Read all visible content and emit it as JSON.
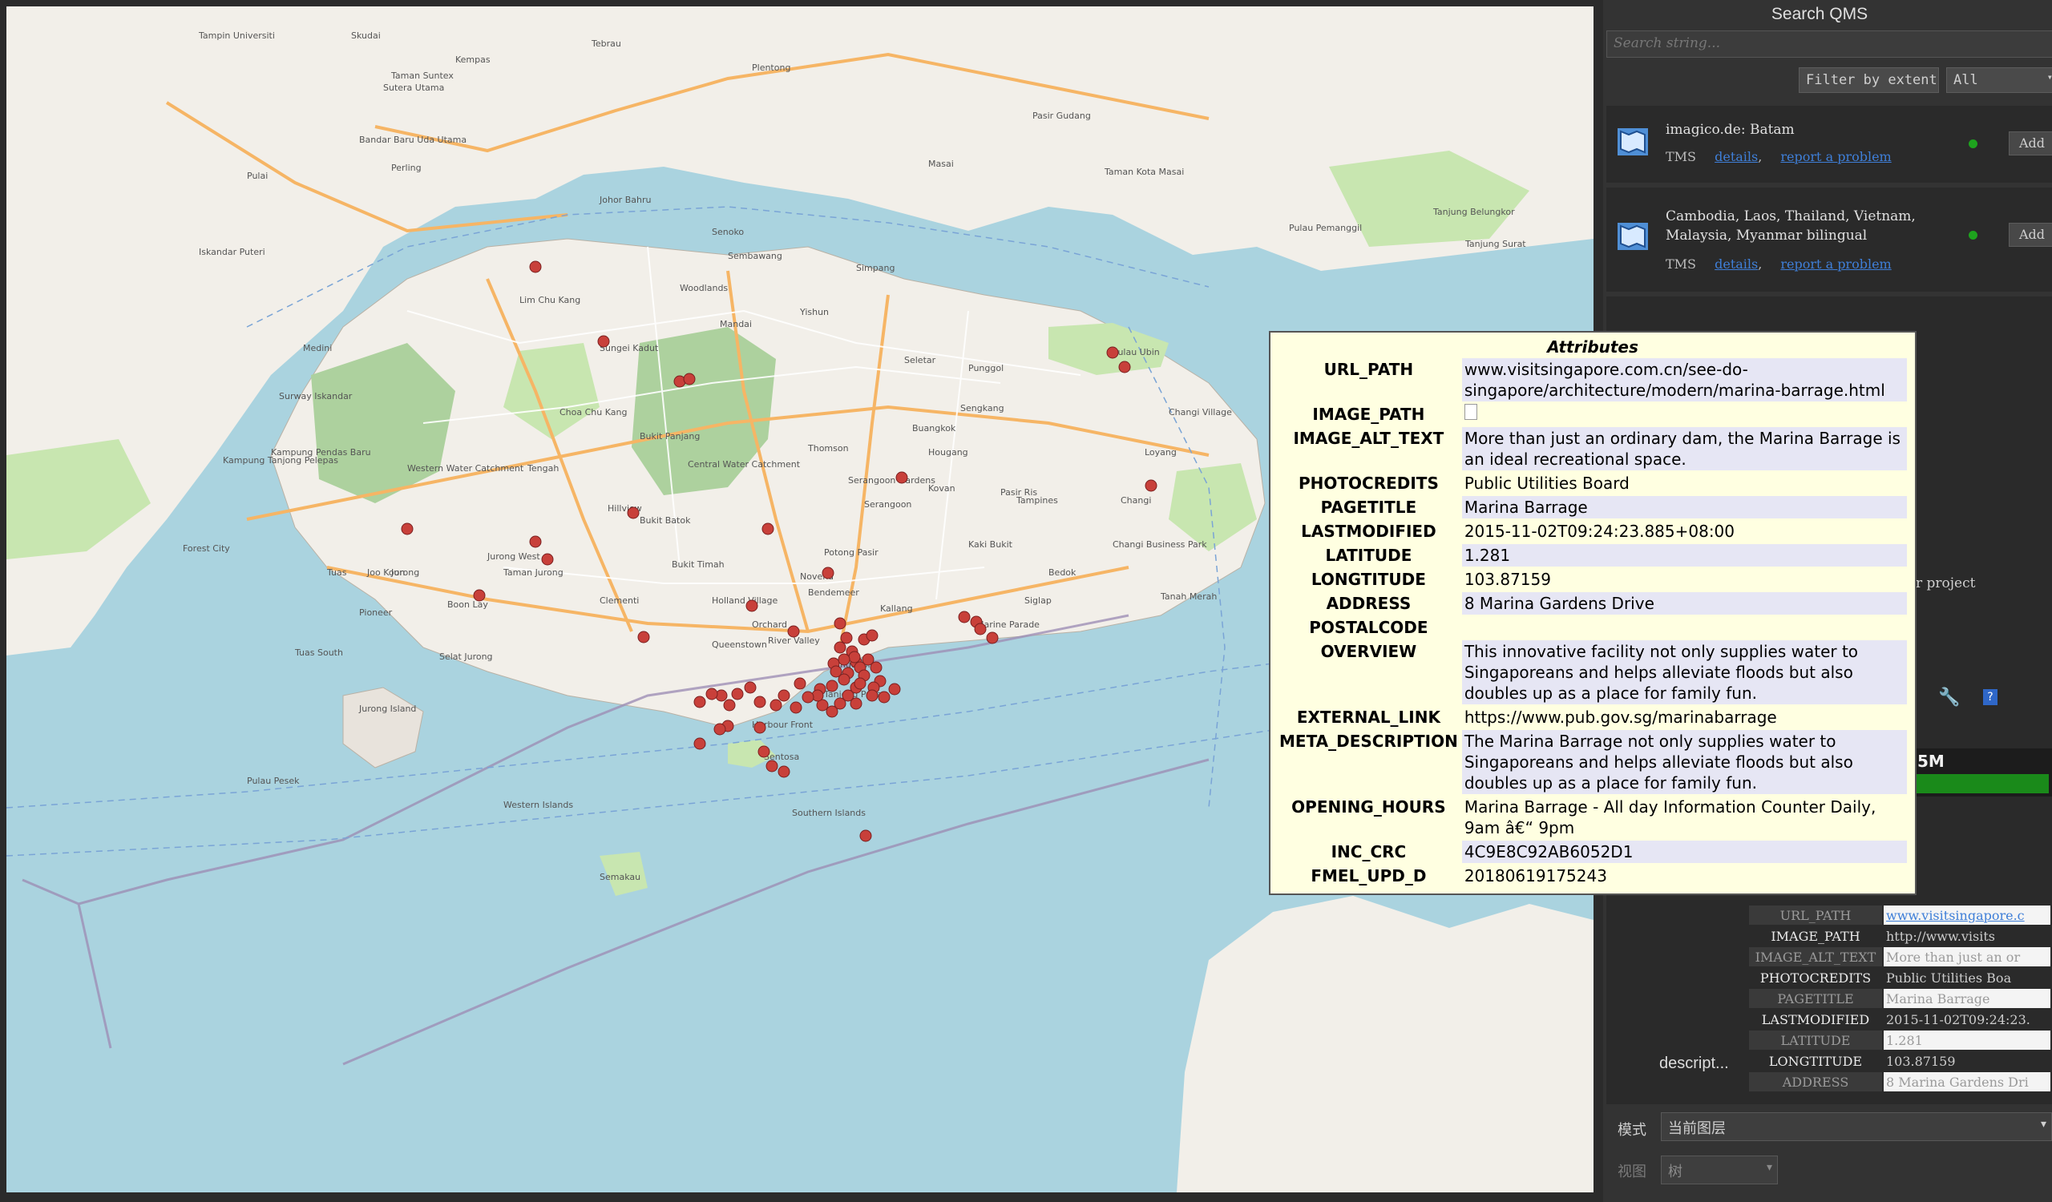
{
  "qms": {
    "title": "Search QMS",
    "search_placeholder": "Search string...",
    "filter_button": "Filter by extent",
    "filter_select": "All",
    "results": [
      {
        "name": "imagico.de: Batam",
        "type": "TMS",
        "details": "details",
        "report": "report a problem",
        "add": "Add"
      },
      {
        "name": "Cambodia, Laos, Thailand, Vietnam, Malaysia, Myanmar bilingual",
        "type": "TMS",
        "details": "details",
        "report": "report a problem",
        "add": "Add"
      }
    ]
  },
  "map": {
    "labels": [
      "Tampin Universiti",
      "Skudai",
      "Tebrau",
      "Plentong",
      "Kempas",
      "Taman Suntex",
      "Sutera Utama",
      "Johor Bahru",
      "Pulai",
      "Bandar Baru Uda Utama",
      "Perling",
      "Iskandar Puteri",
      "Pasir Gudang",
      "Masai",
      "Taman Kota Masai",
      "Senoko",
      "Sembawang",
      "Simpang",
      "Woodlands",
      "Mandai",
      "Lim Chu Kang",
      "Yishun",
      "Sungei Kadut",
      "Seletar",
      "Punggol",
      "Pulau Ubin",
      "Sengkang",
      "Buangkok",
      "Changi Village",
      "Hougang",
      "Serangoon Gardens",
      "Serangoon",
      "Kovan",
      "Pasir Ris",
      "Loyang",
      "Tampines",
      "Changi",
      "Kaki Bukit",
      "Changi Business Park",
      "Bedok",
      "Tanah Merah",
      "Siglap",
      "Marine Parade",
      "Kallang",
      "Potong Pasir",
      "Bendemeer",
      "Novena",
      "Orchard",
      "River Valley",
      "Singapore",
      "Tanjong Pagar",
      "Harbour Front",
      "Sentosa",
      "Southern Islands",
      "Queenstown",
      "Bukit Timah",
      "Holland Village",
      "Clementi",
      "Jurong West",
      "Taman Jurong",
      "Jurong",
      "Joo Koon",
      "Tuas",
      "Pioneer",
      "Boon Lay",
      "Tuas South",
      "Jurong Island",
      "Pulau Pesek",
      "Bukit Batok",
      "Hillview",
      "Bukit Panjang",
      "Choa Chu Kang",
      "Tengah",
      "Western Water Catchment",
      "Central Water Catchment",
      "Thomson",
      "Medini",
      "Surway Iskandar",
      "Kampung Pendas Baru",
      "Kampung Tanjong Pelepas",
      "Forest City",
      "Western Islands",
      "Selat Jurong",
      "Semakau",
      "Tanjung Surat",
      "Pulau Pemanggil",
      "Tanjung Belungkor"
    ],
    "scale_hint": "descript..."
  },
  "attributes": {
    "title": "Attributes",
    "rows": [
      {
        "key": "URL_PATH",
        "value": "www.visitsingapore.com.cn/see-do-singapore/architecture/modern/marina-barrage.html"
      },
      {
        "key": "IMAGE_PATH",
        "value": ""
      },
      {
        "key": "IMAGE_ALT_TEXT",
        "value": "More than just an ordinary dam, the Marina Barrage is an ideal recreational space."
      },
      {
        "key": "PHOTOCREDITS",
        "value": "Public Utilities Board"
      },
      {
        "key": "PAGETITLE",
        "value": "Marina Barrage"
      },
      {
        "key": "LASTMODIFIED",
        "value": "2015-11-02T09:24:23.885+08:00"
      },
      {
        "key": "LATITUDE",
        "value": "1.281"
      },
      {
        "key": "LONGTITUDE",
        "value": "103.87159"
      },
      {
        "key": "ADDRESS",
        "value": "8 Marina Gardens Drive"
      },
      {
        "key": "POSTALCODE",
        "value": ""
      },
      {
        "key": "OVERVIEW",
        "value": "This innovative facility not only supplies water to Singaporeans and helps alleviate floods but also doubles up as a place for family fun."
      },
      {
        "key": "EXTERNAL_LINK",
        "value": "https://www.pub.gov.sg/marinabarrage"
      },
      {
        "key": "META_DESCRIPTION",
        "value": "The Marina Barrage not only supplies water to Singaporeans and helps alleviate floods but also doubles up as a place for family fun."
      },
      {
        "key": "OPENING_HOURS",
        "value": "Marina Barrage - All day Information Counter Daily, 9am â€“ 9pm"
      },
      {
        "key": "INC_CRC",
        "value": "4C9E8C92AB6052D1"
      },
      {
        "key": "FMEL_UPD_D",
        "value": "20180619175243"
      }
    ]
  },
  "identify": {
    "project_text": "r project",
    "osm_text": "5M",
    "rows": [
      {
        "key": "URL_PATH",
        "value": "www.visitsingapore.c"
      },
      {
        "key": "IMAGE_PATH",
        "value": "http://www.visits"
      },
      {
        "key": "IMAGE_ALT_TEXT",
        "value": "More than just an or"
      },
      {
        "key": "PHOTOCREDITS",
        "value": "Public Utilities Boa"
      },
      {
        "key": "PAGETITLE",
        "value": "Marina Barrage"
      },
      {
        "key": "LASTMODIFIED",
        "value": "2015-11-02T09:24:23."
      },
      {
        "key": "LATITUDE",
        "value": "1.281"
      },
      {
        "key": "LONGTITUDE",
        "value": "103.87159"
      },
      {
        "key": "ADDRESS",
        "value": "8 Marina Gardens Dri"
      }
    ],
    "mode_label": "模式",
    "mode_value": "当前图层",
    "view_label": "视图",
    "view_value": "树"
  },
  "colors": {
    "water": "#aad3df",
    "land": "#f2efe9",
    "park": "#c8e6b0",
    "forest": "#add19e",
    "point": "#c8403a",
    "popup_bg": "#ffffe1"
  }
}
